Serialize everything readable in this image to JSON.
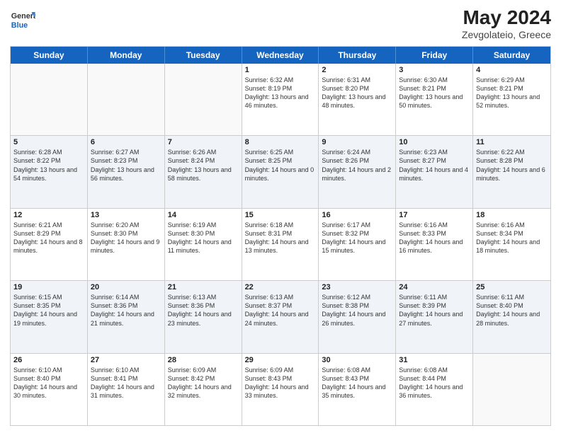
{
  "header": {
    "logo": {
      "general": "General",
      "blue": "Blue"
    },
    "title": "May 2024",
    "location": "Zevgolateio, Greece"
  },
  "days_of_week": [
    "Sunday",
    "Monday",
    "Tuesday",
    "Wednesday",
    "Thursday",
    "Friday",
    "Saturday"
  ],
  "weeks": [
    [
      {
        "day": "",
        "empty": true
      },
      {
        "day": "",
        "empty": true
      },
      {
        "day": "",
        "empty": true
      },
      {
        "day": "1",
        "sunrise": "Sunrise: 6:32 AM",
        "sunset": "Sunset: 8:19 PM",
        "daylight": "Daylight: 13 hours and 46 minutes."
      },
      {
        "day": "2",
        "sunrise": "Sunrise: 6:31 AM",
        "sunset": "Sunset: 8:20 PM",
        "daylight": "Daylight: 13 hours and 48 minutes."
      },
      {
        "day": "3",
        "sunrise": "Sunrise: 6:30 AM",
        "sunset": "Sunset: 8:21 PM",
        "daylight": "Daylight: 13 hours and 50 minutes."
      },
      {
        "day": "4",
        "sunrise": "Sunrise: 6:29 AM",
        "sunset": "Sunset: 8:21 PM",
        "daylight": "Daylight: 13 hours and 52 minutes."
      }
    ],
    [
      {
        "day": "5",
        "sunrise": "Sunrise: 6:28 AM",
        "sunset": "Sunset: 8:22 PM",
        "daylight": "Daylight: 13 hours and 54 minutes."
      },
      {
        "day": "6",
        "sunrise": "Sunrise: 6:27 AM",
        "sunset": "Sunset: 8:23 PM",
        "daylight": "Daylight: 13 hours and 56 minutes."
      },
      {
        "day": "7",
        "sunrise": "Sunrise: 6:26 AM",
        "sunset": "Sunset: 8:24 PM",
        "daylight": "Daylight: 13 hours and 58 minutes."
      },
      {
        "day": "8",
        "sunrise": "Sunrise: 6:25 AM",
        "sunset": "Sunset: 8:25 PM",
        "daylight": "Daylight: 14 hours and 0 minutes."
      },
      {
        "day": "9",
        "sunrise": "Sunrise: 6:24 AM",
        "sunset": "Sunset: 8:26 PM",
        "daylight": "Daylight: 14 hours and 2 minutes."
      },
      {
        "day": "10",
        "sunrise": "Sunrise: 6:23 AM",
        "sunset": "Sunset: 8:27 PM",
        "daylight": "Daylight: 14 hours and 4 minutes."
      },
      {
        "day": "11",
        "sunrise": "Sunrise: 6:22 AM",
        "sunset": "Sunset: 8:28 PM",
        "daylight": "Daylight: 14 hours and 6 minutes."
      }
    ],
    [
      {
        "day": "12",
        "sunrise": "Sunrise: 6:21 AM",
        "sunset": "Sunset: 8:29 PM",
        "daylight": "Daylight: 14 hours and 8 minutes."
      },
      {
        "day": "13",
        "sunrise": "Sunrise: 6:20 AM",
        "sunset": "Sunset: 8:30 PM",
        "daylight": "Daylight: 14 hours and 9 minutes."
      },
      {
        "day": "14",
        "sunrise": "Sunrise: 6:19 AM",
        "sunset": "Sunset: 8:30 PM",
        "daylight": "Daylight: 14 hours and 11 minutes."
      },
      {
        "day": "15",
        "sunrise": "Sunrise: 6:18 AM",
        "sunset": "Sunset: 8:31 PM",
        "daylight": "Daylight: 14 hours and 13 minutes."
      },
      {
        "day": "16",
        "sunrise": "Sunrise: 6:17 AM",
        "sunset": "Sunset: 8:32 PM",
        "daylight": "Daylight: 14 hours and 15 minutes."
      },
      {
        "day": "17",
        "sunrise": "Sunrise: 6:16 AM",
        "sunset": "Sunset: 8:33 PM",
        "daylight": "Daylight: 14 hours and 16 minutes."
      },
      {
        "day": "18",
        "sunrise": "Sunrise: 6:16 AM",
        "sunset": "Sunset: 8:34 PM",
        "daylight": "Daylight: 14 hours and 18 minutes."
      }
    ],
    [
      {
        "day": "19",
        "sunrise": "Sunrise: 6:15 AM",
        "sunset": "Sunset: 8:35 PM",
        "daylight": "Daylight: 14 hours and 19 minutes."
      },
      {
        "day": "20",
        "sunrise": "Sunrise: 6:14 AM",
        "sunset": "Sunset: 8:36 PM",
        "daylight": "Daylight: 14 hours and 21 minutes."
      },
      {
        "day": "21",
        "sunrise": "Sunrise: 6:13 AM",
        "sunset": "Sunset: 8:36 PM",
        "daylight": "Daylight: 14 hours and 23 minutes."
      },
      {
        "day": "22",
        "sunrise": "Sunrise: 6:13 AM",
        "sunset": "Sunset: 8:37 PM",
        "daylight": "Daylight: 14 hours and 24 minutes."
      },
      {
        "day": "23",
        "sunrise": "Sunrise: 6:12 AM",
        "sunset": "Sunset: 8:38 PM",
        "daylight": "Daylight: 14 hours and 26 minutes."
      },
      {
        "day": "24",
        "sunrise": "Sunrise: 6:11 AM",
        "sunset": "Sunset: 8:39 PM",
        "daylight": "Daylight: 14 hours and 27 minutes."
      },
      {
        "day": "25",
        "sunrise": "Sunrise: 6:11 AM",
        "sunset": "Sunset: 8:40 PM",
        "daylight": "Daylight: 14 hours and 28 minutes."
      }
    ],
    [
      {
        "day": "26",
        "sunrise": "Sunrise: 6:10 AM",
        "sunset": "Sunset: 8:40 PM",
        "daylight": "Daylight: 14 hours and 30 minutes."
      },
      {
        "day": "27",
        "sunrise": "Sunrise: 6:10 AM",
        "sunset": "Sunset: 8:41 PM",
        "daylight": "Daylight: 14 hours and 31 minutes."
      },
      {
        "day": "28",
        "sunrise": "Sunrise: 6:09 AM",
        "sunset": "Sunset: 8:42 PM",
        "daylight": "Daylight: 14 hours and 32 minutes."
      },
      {
        "day": "29",
        "sunrise": "Sunrise: 6:09 AM",
        "sunset": "Sunset: 8:43 PM",
        "daylight": "Daylight: 14 hours and 33 minutes."
      },
      {
        "day": "30",
        "sunrise": "Sunrise: 6:08 AM",
        "sunset": "Sunset: 8:43 PM",
        "daylight": "Daylight: 14 hours and 35 minutes."
      },
      {
        "day": "31",
        "sunrise": "Sunrise: 6:08 AM",
        "sunset": "Sunset: 8:44 PM",
        "daylight": "Daylight: 14 hours and 36 minutes."
      },
      {
        "day": "",
        "empty": true
      }
    ]
  ]
}
